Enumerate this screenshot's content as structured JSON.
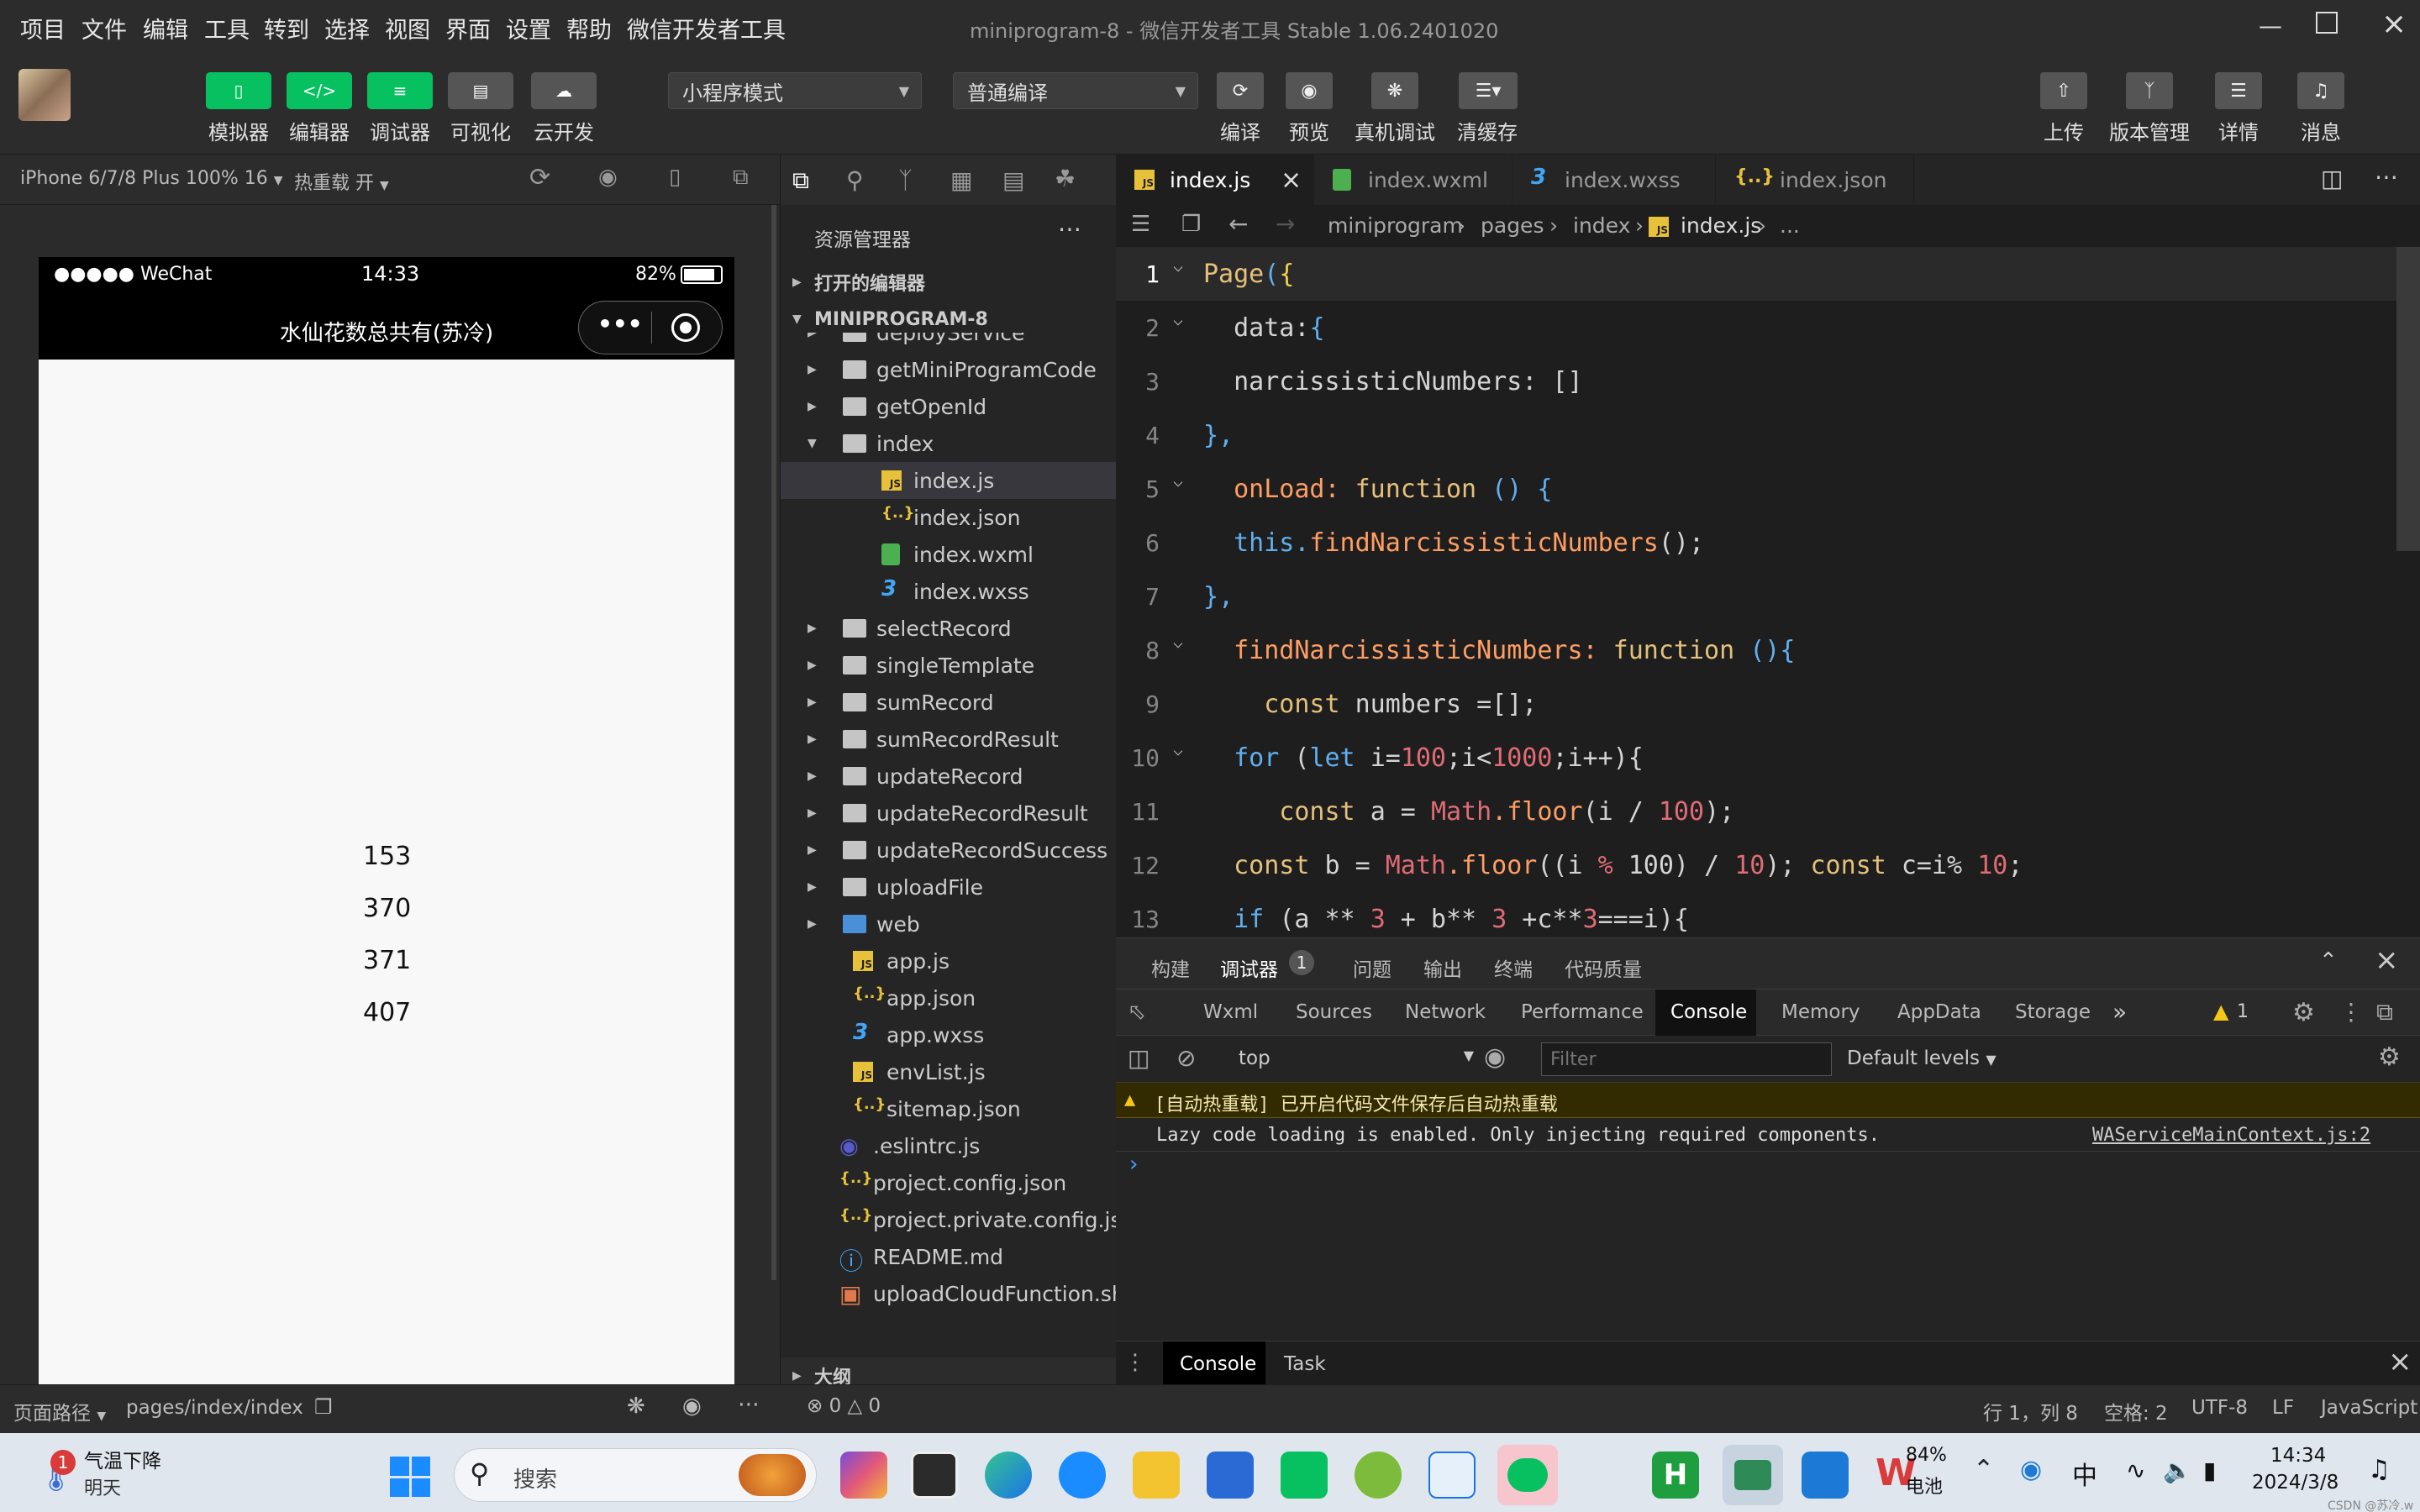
{
  "menubar": {
    "items": [
      "项目",
      "文件",
      "编辑",
      "工具",
      "转到",
      "选择",
      "视图",
      "界面",
      "设置",
      "帮助",
      "微信开发者工具"
    ],
    "title": "miniprogram-8 - 微信开发者工具 Stable 1.06.2401020"
  },
  "toolbar": {
    "simulator": "模拟器",
    "editor": "编辑器",
    "debugger": "调试器",
    "visual": "可视化",
    "cloud": "云开发",
    "mode": "小程序模式",
    "compile_mode": "普通编译",
    "compile": "编译",
    "preview": "预览",
    "device_debug": "真机调试",
    "clear_cache": "清缓存",
    "upload": "上传",
    "version": "版本管理",
    "details": "详情",
    "messages": "消息"
  },
  "simulator": {
    "device": "iPhone 6/7/8 Plus 100% 16",
    "hot_reload": "热重载 开",
    "status_carrier": "●●●●● WeChat",
    "status_time": "14:33",
    "status_battery": "82%",
    "nav_title": "水仙花数总共有(苏冷)",
    "numbers": [
      "153",
      "370",
      "371",
      "407"
    ],
    "page_path_label": "页面路径",
    "page_path": "pages/index/index"
  },
  "explorer": {
    "header": "资源管理器",
    "open_editors": "打开的编辑器",
    "project": "MINIPROGRAM-8",
    "items": [
      {
        "name": "deployService",
        "type": "folder",
        "level": 1
      },
      {
        "name": "getMiniProgramCode",
        "type": "folder",
        "level": 1
      },
      {
        "name": "getOpenId",
        "type": "folder",
        "level": 1
      },
      {
        "name": "index",
        "type": "folder-open",
        "level": 1
      },
      {
        "name": "index.js",
        "type": "js",
        "level": 2
      },
      {
        "name": "index.json",
        "type": "json",
        "level": 2
      },
      {
        "name": "index.wxml",
        "type": "wxml",
        "level": 2
      },
      {
        "name": "index.wxss",
        "type": "wxss",
        "level": 2
      },
      {
        "name": "selectRecord",
        "type": "folder",
        "level": 1
      },
      {
        "name": "singleTemplate",
        "type": "folder",
        "level": 1
      },
      {
        "name": "sumRecord",
        "type": "folder",
        "level": 1
      },
      {
        "name": "sumRecordResult",
        "type": "folder",
        "level": 1
      },
      {
        "name": "updateRecord",
        "type": "folder",
        "level": 1
      },
      {
        "name": "updateRecordResult",
        "type": "folder",
        "level": 1
      },
      {
        "name": "updateRecordSuccess",
        "type": "folder",
        "level": 1
      },
      {
        "name": "uploadFile",
        "type": "folder",
        "level": 1
      },
      {
        "name": "web",
        "type": "folder-web",
        "level": 1
      },
      {
        "name": "app.js",
        "type": "js",
        "level": 0.5
      },
      {
        "name": "app.json",
        "type": "json",
        "level": 0.5
      },
      {
        "name": "app.wxss",
        "type": "wxss",
        "level": 0.5
      },
      {
        "name": "envList.js",
        "type": "js",
        "level": 0.5
      },
      {
        "name": "sitemap.json",
        "type": "json",
        "level": 0.5
      },
      {
        "name": ".eslintrc.js",
        "type": "eslint",
        "level": 0
      },
      {
        "name": "project.config.json",
        "type": "json",
        "level": 0
      },
      {
        "name": "project.private.config.js...",
        "type": "json",
        "level": 0
      },
      {
        "name": "README.md",
        "type": "info",
        "level": 0
      },
      {
        "name": "uploadCloudFunction.sh",
        "type": "sh",
        "level": 0
      }
    ],
    "outline": "大纲",
    "errors": "0",
    "warnings": "0"
  },
  "editor": {
    "tabs": [
      "index.js",
      "index.wxml",
      "index.wxss",
      "index.json"
    ],
    "breadcrumb": [
      "miniprogram",
      "pages",
      "index",
      "index.js",
      "..."
    ],
    "lines": [
      {
        "n": "1",
        "tokens": [
          [
            "Page",
            "k1"
          ],
          [
            "(",
            "kw"
          ],
          [
            "{",
            "yl"
          ]
        ]
      },
      {
        "n": "2",
        "tokens": [
          [
            "  data:",
            "pl"
          ],
          [
            "{",
            "kw"
          ]
        ]
      },
      {
        "n": "3",
        "tokens": [
          [
            "  narcissisticNumbers: []",
            "pl"
          ]
        ]
      },
      {
        "n": "4",
        "tokens": [
          [
            "},",
            "kw"
          ]
        ]
      },
      {
        "n": "5",
        "tokens": [
          [
            "  onLoad: ",
            "or"
          ],
          [
            "function",
            "fn"
          ],
          [
            " () {",
            "kw"
          ]
        ]
      },
      {
        "n": "6",
        "tokens": [
          [
            "  this.",
            "kw"
          ],
          [
            "findNarcissisticNumbers",
            "or"
          ],
          [
            "();",
            "pl"
          ]
        ]
      },
      {
        "n": "7",
        "tokens": [
          [
            "},",
            "kw"
          ]
        ]
      },
      {
        "n": "8",
        "tokens": [
          [
            "  findNarcissisticNumbers: ",
            "or"
          ],
          [
            "function",
            "fn"
          ],
          [
            " (){",
            "kw"
          ]
        ]
      },
      {
        "n": "9",
        "tokens": [
          [
            "    const ",
            "fn"
          ],
          [
            "numbers =[];",
            "pl"
          ]
        ]
      },
      {
        "n": "10",
        "tokens": [
          [
            "  for ",
            "kw"
          ],
          [
            "(",
            "pl"
          ],
          [
            "let ",
            "kw"
          ],
          [
            "i=",
            "pl"
          ],
          [
            "100",
            "num"
          ],
          [
            ";i<",
            "pl"
          ],
          [
            "1000",
            "num"
          ],
          [
            ";i++){",
            "pl"
          ]
        ]
      },
      {
        "n": "11",
        "tokens": [
          [
            "     const ",
            "fn"
          ],
          [
            "a = ",
            "pl"
          ],
          [
            "Math",
            "num"
          ],
          [
            ".floor",
            "or"
          ],
          [
            "(i / ",
            "pl"
          ],
          [
            "100",
            "num"
          ],
          [
            ");",
            "pl"
          ]
        ]
      },
      {
        "n": "12",
        "tokens": [
          [
            "  const ",
            "fn"
          ],
          [
            "b = ",
            "pl"
          ],
          [
            "Math",
            "num"
          ],
          [
            ".floor",
            "or"
          ],
          [
            "((i ",
            "pl"
          ],
          [
            "%",
            "num"
          ],
          [
            " 100) / ",
            "pl"
          ],
          [
            "10",
            "num"
          ],
          [
            "); ",
            "pl"
          ],
          [
            "const ",
            "fn"
          ],
          [
            "c=i% ",
            "pl"
          ],
          [
            "10",
            "num"
          ],
          [
            ";",
            "pl"
          ]
        ]
      },
      {
        "n": "13",
        "tokens": [
          [
            "  if ",
            "kw"
          ],
          [
            "(a ** ",
            "pl"
          ],
          [
            "3",
            "num"
          ],
          [
            " + b** ",
            "pl"
          ],
          [
            "3",
            "num"
          ],
          [
            " +c**",
            "pl"
          ],
          [
            "3",
            "num"
          ],
          [
            "===i){",
            "pl"
          ]
        ]
      }
    ]
  },
  "devtools": {
    "top_tabs": [
      "构建",
      "调试器",
      "问题",
      "输出",
      "终端",
      "代码质量"
    ],
    "debugger_badge": "1",
    "panel_tabs": [
      "Wxml",
      "Sources",
      "Network",
      "Performance",
      "Console",
      "Memory",
      "AppData",
      "Storage"
    ],
    "warn_count": "1",
    "context": "top",
    "filter_placeholder": "Filter",
    "levels": "Default levels",
    "warn_msg": "[自动热重载] 已开启代码文件保存后自动热重载",
    "info_msg": "Lazy code loading is enabled. Only injecting required components.",
    "info_src": "WAServiceMainContext.js:2",
    "bottom_tabs": [
      "Console",
      "Task"
    ]
  },
  "statusbar": {
    "position": "行 1，列 8",
    "spaces": "空格: 2",
    "encoding": "UTF-8",
    "eol": "LF",
    "lang": "JavaScript"
  },
  "taskbar": {
    "weather_badge": "1",
    "weather_title": "气温下降",
    "weather_sub": "明天",
    "search": "搜索",
    "battery_pct": "84%",
    "battery_label": "电池",
    "ime": "中",
    "time": "14:34",
    "date": "2024/3/8",
    "watermark": "CSDN @苏冷.w"
  },
  "colors": {
    "accent_green": "#07c160",
    "editor_bg": "#1e1e1e",
    "warn_yellow": "#f5c518"
  }
}
